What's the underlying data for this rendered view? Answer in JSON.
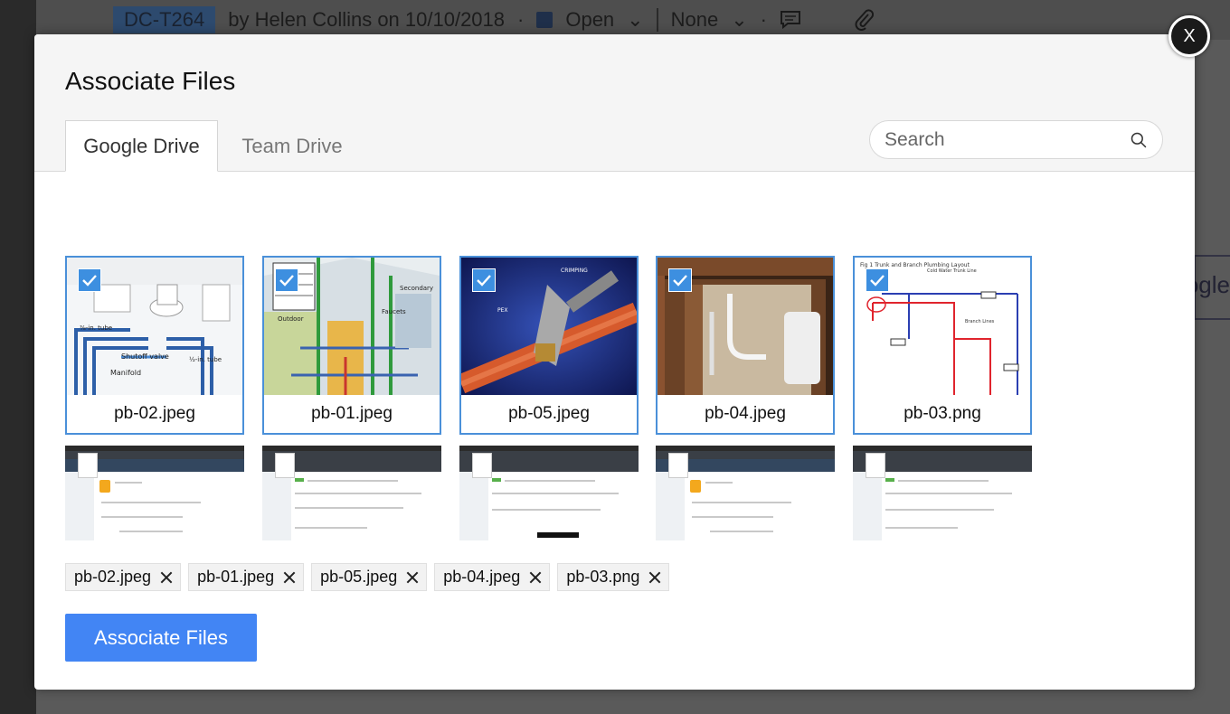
{
  "background": {
    "ticket_id": "DC-T264",
    "byline": "by Helen Collins on 10/10/2018",
    "status": "Open",
    "assignee": "None",
    "right_text": "ogle"
  },
  "modal": {
    "title": "Associate Files",
    "close_label": "X",
    "tabs": [
      {
        "label": "Google Drive",
        "active": true
      },
      {
        "label": "Team Drive",
        "active": false
      }
    ],
    "search": {
      "placeholder": "Search",
      "value": ""
    },
    "files": [
      {
        "name": "pb-02.jpeg",
        "selected": true
      },
      {
        "name": "pb-01.jpeg",
        "selected": true
      },
      {
        "name": "pb-05.jpeg",
        "selected": true
      },
      {
        "name": "pb-04.jpeg",
        "selected": true
      },
      {
        "name": "pb-03.png",
        "selected": true
      }
    ],
    "selected_chips": [
      "pb-02.jpeg",
      "pb-01.jpeg",
      "pb-05.jpeg",
      "pb-04.jpeg",
      "pb-03.png"
    ],
    "submit_label": "Associate Files"
  },
  "colors": {
    "accent": "#4285f4",
    "selection_border": "#4a90d9",
    "check": "#3d8fe0"
  }
}
